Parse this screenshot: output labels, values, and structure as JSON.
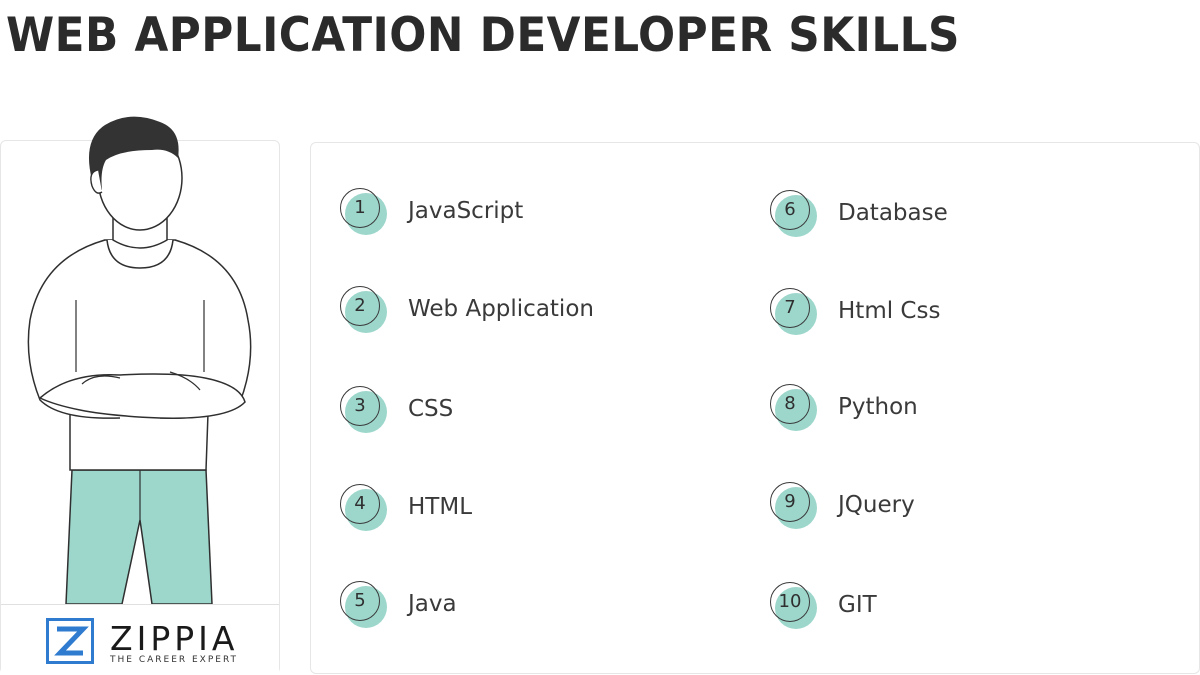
{
  "title": "WEB APPLICATION DEVELOPER SKILLS",
  "brand": {
    "name": "ZIPPIA",
    "tagline": "THE CAREER EXPERT",
    "logo_icon": "zippia-z-logo",
    "accent": "#2e7bcf"
  },
  "illustration": {
    "icon": "person-arms-crossed-icon",
    "pants_color": "#9dd7cc"
  },
  "badge_color": "#9dd7cc",
  "skills": [
    {
      "num": "1",
      "label": "JavaScript"
    },
    {
      "num": "2",
      "label": "Web Application"
    },
    {
      "num": "3",
      "label": "CSS"
    },
    {
      "num": "4",
      "label": "HTML"
    },
    {
      "num": "5",
      "label": "Java"
    },
    {
      "num": "6",
      "label": "Database"
    },
    {
      "num": "7",
      "label": "Html Css"
    },
    {
      "num": "8",
      "label": "Python"
    },
    {
      "num": "9",
      "label": "JQuery"
    },
    {
      "num": "10",
      "label": "GIT"
    }
  ]
}
